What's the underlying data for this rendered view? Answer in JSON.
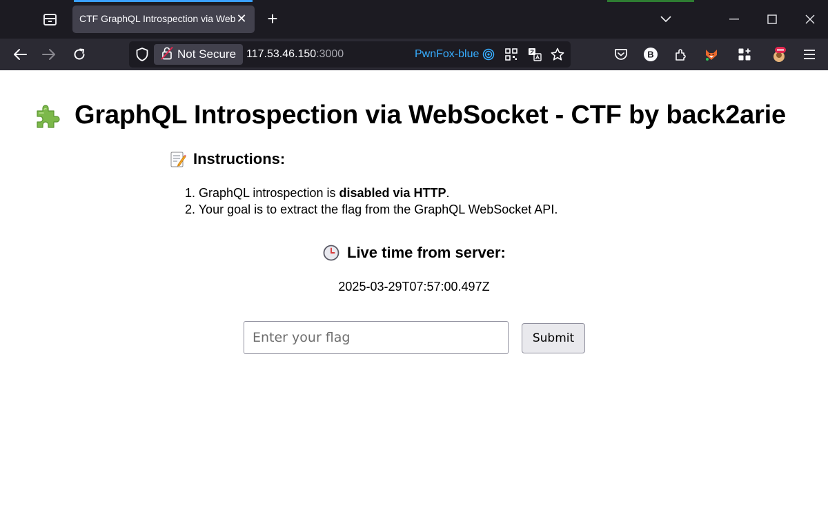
{
  "browser": {
    "tab": {
      "title": "CTF GraphQL Introspection via WebSocket",
      "close": "✕"
    },
    "new_tab": "+",
    "url": {
      "security_label": "Not Secure",
      "host": "117.53.46.150",
      "port": ":3000",
      "container_label": "PwnFox-blue"
    },
    "icons": [
      "tab-list-icon",
      "back-icon",
      "forward-icon",
      "reload-icon",
      "shield-icon",
      "lock-warning-icon",
      "fingerprint-icon",
      "qr-icon",
      "translate-icon",
      "star-icon",
      "pocket-icon",
      "b-extension-icon",
      "extensions-icon",
      "fox-icon",
      "apps-icon",
      "avatar-extension-icon",
      "menu-icon"
    ],
    "colors": {
      "tab_bg": "#1c1b22",
      "nav_bg": "#2b2a33",
      "active_tab": "#42414d",
      "container_blue": "#37adff"
    }
  },
  "page": {
    "title_emoji": "puzzle-piece-icon",
    "title": "GraphQL Introspection via WebSocket - CTF by back2arie",
    "instructions_heading": "Instructions:",
    "instructions": [
      {
        "number": "1.",
        "before": "GraphQL introspection is ",
        "bold": "disabled via HTTP",
        "after": "."
      },
      {
        "number": "2.",
        "before": "Your goal is to extract the flag from the GraphQL WebSocket API.",
        "bold": "",
        "after": ""
      }
    ],
    "time_heading": "Live time from server:",
    "time_value": "2025-03-29T07:57:00.497Z",
    "flag_input": {
      "placeholder": "Enter your flag",
      "value": ""
    },
    "submit_label": "Submit"
  }
}
